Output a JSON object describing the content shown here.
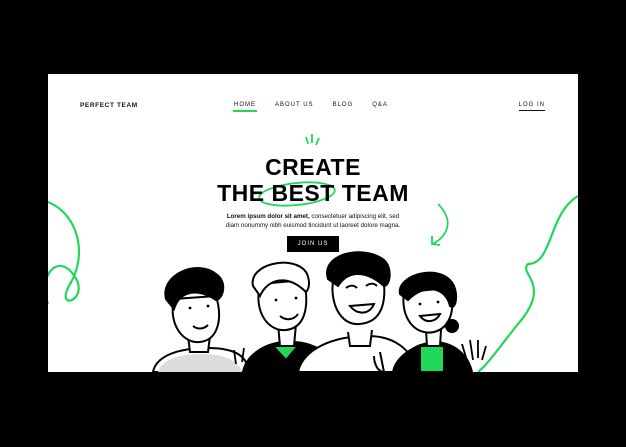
{
  "brand": {
    "name": "PERFECT TEAM"
  },
  "nav": {
    "items": [
      {
        "label": "HOME",
        "active": true
      },
      {
        "label": "ABOUT US",
        "active": false
      },
      {
        "label": "BLOG",
        "active": false
      },
      {
        "label": "Q&A",
        "active": false
      }
    ],
    "login_label": "LOG IN"
  },
  "hero": {
    "line1": "CREATE",
    "line2_a": "THE",
    "line2_b": "BEST",
    "line2_c": "TEAM",
    "desc_bold": "Lorem ipsum dolor sit amet,",
    "desc_rest": " consectetuer adipiscing elit, sed",
    "desc_line2": "diam nonummy nibh euismod tincidunt ut laoreet dolore magna.",
    "cta_label": "JOIN US"
  },
  "colors": {
    "accent": "#22d65a",
    "ink": "#000000",
    "background": "#ffffff",
    "outer": "#000000"
  }
}
